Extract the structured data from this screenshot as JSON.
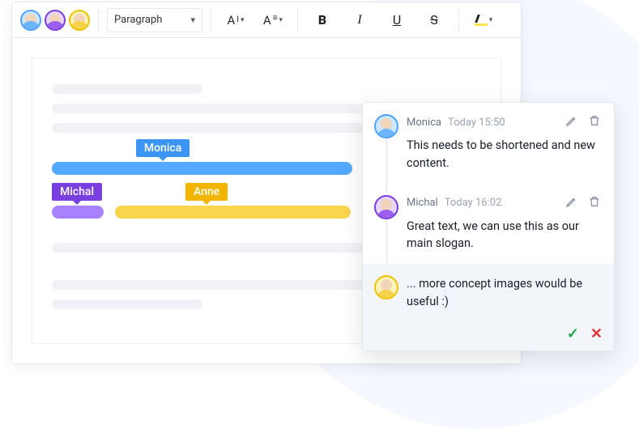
{
  "toolbar": {
    "style_select": "Paragraph",
    "collaborators": [
      {
        "name": "Monica",
        "color": "blue"
      },
      {
        "name": "Michal",
        "color": "purple"
      },
      {
        "name": "Anne",
        "color": "yellow"
      }
    ]
  },
  "selections": {
    "monica_tag": "Monica",
    "michal_tag": "Michal",
    "anne_tag": "Anne"
  },
  "comments": [
    {
      "author": "Monica",
      "timestamp": "Today 15:50",
      "text": "This needs to be shortened and new content."
    },
    {
      "author": "Michal",
      "timestamp": "Today 16:02",
      "text": "Great text, we can use this as our main slogan."
    }
  ],
  "reply": {
    "text": "... more concept images would be useful :)"
  }
}
